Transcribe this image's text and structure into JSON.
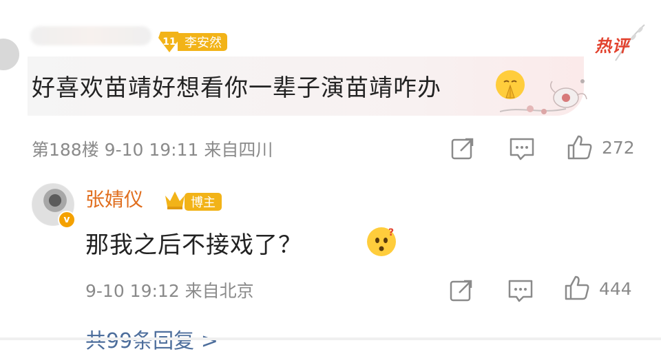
{
  "comment": {
    "fan_level": "11",
    "fan_name": "李安然",
    "hot_tag": "热评",
    "text": "好喜欢苗靖好想看你一辈子演苗靖咋办",
    "emoji_icon": "pray-emoji-icon",
    "meta": "第188楼  9-10 19:11  来自四川",
    "like_count": "272"
  },
  "reply": {
    "author_name": "张婧仪",
    "author_badge": "博主",
    "verified_mark": "v",
    "text": "那我之后不接戏了？",
    "emoji_icon": "question-emoji-icon",
    "meta": "9-10 19:12  来自北京",
    "like_count": "444"
  },
  "replies_link": "共99条回复 >",
  "colors": {
    "fan_badge": "#f2b318",
    "hot": "#e2422e",
    "author": "#e06e1e",
    "meta_gray": "#8a8a8a",
    "link": "#4d6e9c"
  }
}
